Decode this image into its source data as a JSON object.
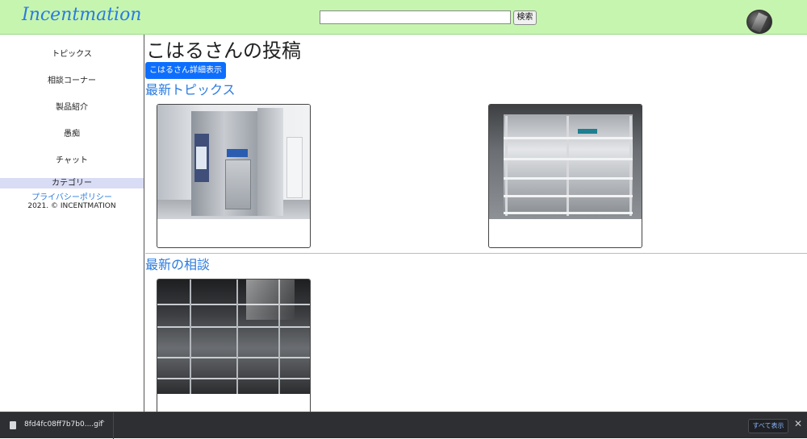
{
  "header": {
    "logo": "Incentmation",
    "search_placeholder": "",
    "search_button": "検索"
  },
  "sidebar": {
    "items": [
      {
        "label": "トピックス"
      },
      {
        "label": "相談コーナー"
      },
      {
        "label": "製品紹介"
      },
      {
        "label": "愚痴"
      },
      {
        "label": "チャット"
      }
    ],
    "category": "カテゴリー",
    "privacy": "プライバシーポリシー",
    "copyright": "2021. © INCENTMATION"
  },
  "main": {
    "page_title": "こはるさんの投稿",
    "detail_button": "こはるさん詳細表示",
    "latest_topics_title": "最新トピックス",
    "latest_consult_title": "最新の相談"
  },
  "downloads": {
    "file_name": "8fd4fc08ff7b7b0....gif",
    "show_all": "すべて表示",
    "close": "✕",
    "chevron": "^"
  },
  "colors": {
    "header_bg": "#c6f5b0",
    "accent": "#2a7be0",
    "primary_button": "#0d6efd",
    "category_bg": "#d9dcf5"
  }
}
